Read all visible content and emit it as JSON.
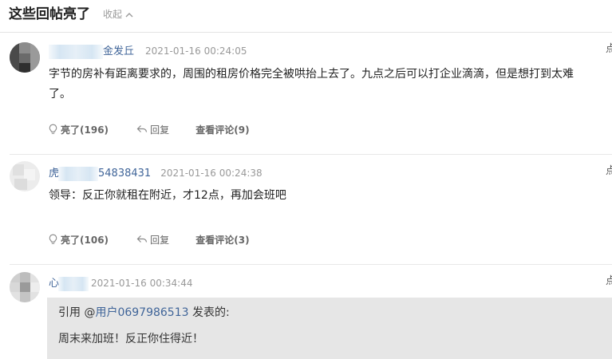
{
  "header": {
    "title": "这些回帖亮了",
    "collapse_label": "收起",
    "chevron_icon": "chevron-up-icon"
  },
  "comments": [
    {
      "username": "金发丘",
      "time": "2021-01-16 00:24:05",
      "content": "字节的房补有距离要求的，周围的租房价格完全被哄抬上去了。九点之后可以打企业滴滴，但是想打到太难了。",
      "like_label": "亮了",
      "like_count": "(196)",
      "reply_label": "回复",
      "view_label": "查看评论",
      "view_count": "(9)",
      "more": "点"
    },
    {
      "username_prefix": "虎",
      "username": "54838431",
      "time": "2021-01-16 00:24:38",
      "content": "领导：反正你就租在附近，才12点，再加会班吧",
      "like_label": "亮了",
      "like_count": "(106)",
      "reply_label": "回复",
      "view_label": "查看评论",
      "view_count": "(3)",
      "more": "点"
    },
    {
      "username": "心",
      "time": "2021-01-16 00:34:44",
      "more": "点",
      "quote": {
        "prefix": "引用 @",
        "user": "用户0697986513",
        "suffix": " 发表的:",
        "text": "周末来加班！反正你住得近！"
      }
    }
  ],
  "colors": {
    "link": "#406599",
    "muted": "#999999",
    "quote_bg": "#e6e6e6"
  }
}
